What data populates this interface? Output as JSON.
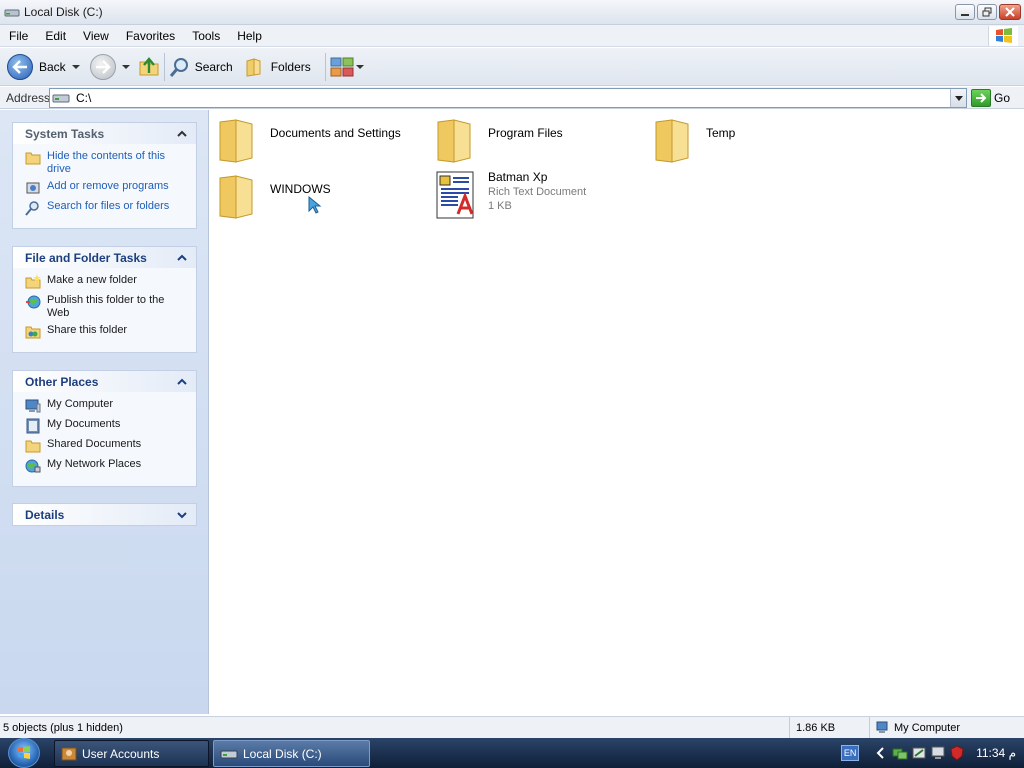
{
  "window": {
    "title": "Local Disk (C:)"
  },
  "menu": [
    "File",
    "Edit",
    "View",
    "Favorites",
    "Tools",
    "Help"
  ],
  "toolbar": {
    "back_label": "Back",
    "search_label": "Search",
    "folders_label": "Folders"
  },
  "address": {
    "label": "Address",
    "value": "C:\\",
    "go_label": "Go"
  },
  "left_pane": {
    "system_tasks": {
      "title": "System Tasks",
      "items": [
        "Hide the contents of this drive",
        "Add or remove programs",
        "Search for files or folders"
      ]
    },
    "file_folder_tasks": {
      "title": "File and Folder Tasks",
      "items": [
        "Make a new folder",
        "Publish this folder to the Web",
        "Share this folder"
      ]
    },
    "other_places": {
      "title": "Other Places",
      "items": [
        "My Computer",
        "My Documents",
        "Shared Documents",
        "My Network Places"
      ]
    },
    "details": {
      "title": "Details"
    }
  },
  "files": [
    {
      "name": "Documents and Settings",
      "type": "folder"
    },
    {
      "name": "Program Files",
      "type": "folder"
    },
    {
      "name": "Temp",
      "type": "folder"
    },
    {
      "name": "WINDOWS",
      "type": "folder"
    },
    {
      "name": "Batman Xp",
      "type": "rtf",
      "subtitle": "Rich Text Document",
      "size": "1 KB"
    }
  ],
  "status": {
    "objects": "5 objects (plus 1 hidden)",
    "size": "1.86 KB",
    "location": "My Computer"
  },
  "taskbar": {
    "buttons": [
      "User Accounts",
      "Local Disk (C:)"
    ],
    "lang": "EN",
    "clock": "11:34 م"
  },
  "colors": {
    "link_blue": "#1f5fb8",
    "panel_title": "#1d3f7d",
    "taskbar": "#1d3354"
  }
}
